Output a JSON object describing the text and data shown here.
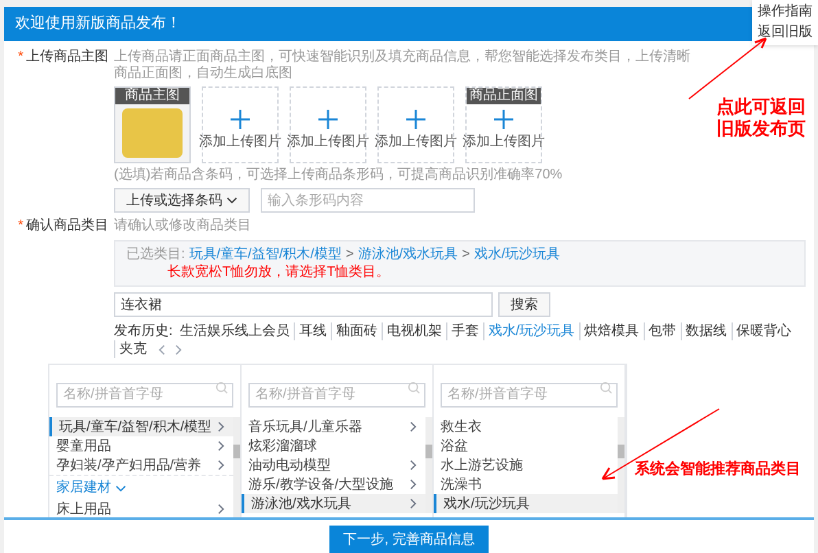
{
  "header": {
    "title": "欢迎使用新版商品发布！"
  },
  "top_menu": [
    {
      "label": "操作指南"
    },
    {
      "label": "返回旧版"
    }
  ],
  "upload": {
    "mark": "*",
    "label": "上传商品主图",
    "hint": "上传商品请正面商品主图，可快速智能识别及填充商品信息，帮您智能选择发布类目，上传清晰商品正面图，自动生成白底图",
    "tiles": [
      {
        "kind": "image",
        "tag": "商品主图"
      },
      {
        "kind": "empty",
        "text": "添加上传图片"
      },
      {
        "kind": "empty",
        "text": "添加上传图片"
      },
      {
        "kind": "empty",
        "text": "添加上传图片"
      },
      {
        "kind": "empty",
        "tag": "商品正面图",
        "text": "添加上传图片"
      }
    ],
    "barcode_note": "(选填)若商品含条码，可选择上传商品条形码，可提高商品识别准确率70%",
    "barcode_button": "上传或选择条码",
    "barcode_input": {
      "placeholder": "输入条形码内容"
    }
  },
  "category": {
    "mark": "*",
    "label": "确认商品类目",
    "hint": "请确认或修改商品类目",
    "selected_label": "已选类目:",
    "path": [
      {
        "kind": "link",
        "text": "玩具/童车/益智/积木/模型"
      },
      {
        "kind": "separator",
        "text": ">"
      },
      {
        "kind": "link",
        "text": "游泳池/戏水玩具"
      },
      {
        "kind": "separator",
        "text": ">"
      },
      {
        "kind": "link",
        "text": "戏水/玩沙玩具"
      }
    ],
    "warning": "长款宽松T恤勿放，请选择T恤类目。",
    "search": {
      "value": "连衣裙",
      "button": "搜索"
    },
    "history": {
      "label": "发布历史:",
      "items": [
        {
          "label": "生活娱乐线上会员",
          "selected": false
        },
        {
          "label": "耳线",
          "selected": false
        },
        {
          "label": "釉面砖",
          "selected": false
        },
        {
          "label": "电视机架",
          "selected": false
        },
        {
          "label": "手套",
          "selected": false
        },
        {
          "label": "戏水/玩沙玩具",
          "selected": true
        },
        {
          "label": "烘焙模具",
          "selected": false
        },
        {
          "label": "包带",
          "selected": false
        },
        {
          "label": "数据线",
          "selected": false
        },
        {
          "label": "保暖背心",
          "selected": false
        },
        {
          "label": "夹克",
          "selected": false
        }
      ]
    },
    "columns": [
      {
        "search": {
          "placeholder": "名称/拼音首字母"
        },
        "items": [
          {
            "kind": "item",
            "label": "玩具/童车/益智/积木/模型",
            "has_children": true,
            "selected": true
          },
          {
            "kind": "item",
            "label": "婴童用品",
            "has_children": true,
            "selected": false
          },
          {
            "kind": "item",
            "label": "孕妇装/孕产妇用品/营养",
            "has_children": true,
            "selected": false
          },
          {
            "kind": "group",
            "label": "家居建材"
          },
          {
            "kind": "item",
            "label": "床上用品",
            "has_children": true,
            "selected": false
          }
        ]
      },
      {
        "search": {
          "placeholder": "名称/拼音首字母"
        },
        "items": [
          {
            "kind": "item",
            "label": "音乐玩具/儿童乐器",
            "has_children": true,
            "selected": false
          },
          {
            "kind": "item",
            "label": "炫彩溜溜球",
            "has_children": false,
            "selected": false
          },
          {
            "kind": "item",
            "label": "油动电动模型",
            "has_children": true,
            "selected": false
          },
          {
            "kind": "item",
            "label": "游乐/教学设备/大型设施",
            "has_children": true,
            "selected": false
          },
          {
            "kind": "item",
            "label": "游泳池/戏水玩具",
            "has_children": true,
            "selected": true
          }
        ]
      },
      {
        "search": {
          "placeholder": "名称/拼音首字母"
        },
        "items": [
          {
            "kind": "item",
            "label": "救生衣",
            "has_children": false,
            "selected": false
          },
          {
            "kind": "item",
            "label": "浴盆",
            "has_children": false,
            "selected": false
          },
          {
            "kind": "item",
            "label": "水上游艺设施",
            "has_children": false,
            "selected": false
          },
          {
            "kind": "item",
            "label": "洗澡书",
            "has_children": false,
            "selected": false
          },
          {
            "kind": "item",
            "label": "戏水/玩沙玩具",
            "has_children": false,
            "selected": true
          }
        ]
      }
    ]
  },
  "annotations": [
    {
      "text": "点此可返回旧版发布页"
    },
    {
      "text": "系统会智能推荐商品类目"
    }
  ],
  "footer": {
    "button": "下一步, 完善商品信息"
  }
}
